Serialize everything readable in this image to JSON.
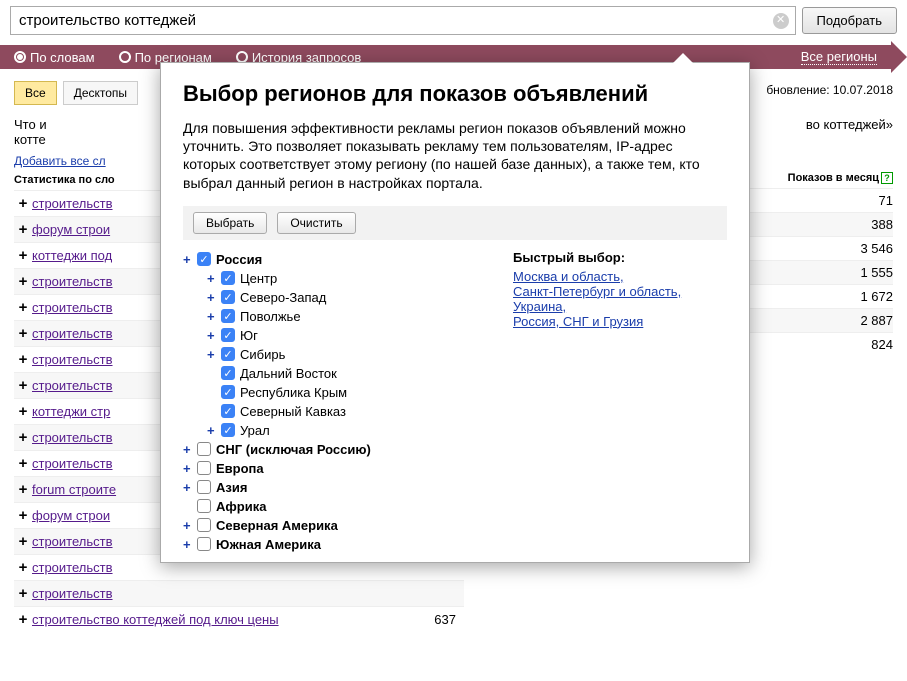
{
  "search": {
    "value": "строительство коттеджей",
    "submit": "Подобрать"
  },
  "modes": {
    "by_words": "По словам",
    "by_regions": "По регионам",
    "history": "История запросов",
    "all_regions": "Все регионы"
  },
  "tabs": {
    "all": "Все",
    "desktop": "Десктопы"
  },
  "update_label": "бновление: 10.07.2018",
  "left": {
    "heading1": "Что и",
    "heading2": "котте",
    "add_all": "Добавить все сл",
    "stat_header": "Статистика по сло"
  },
  "right": {
    "heading_suffix": "во коттеджей»",
    "shows_label": "Показов в месяц"
  },
  "keywords": [
    {
      "text": "строительств",
      "count": ""
    },
    {
      "text": "форум строи",
      "count": ""
    },
    {
      "text": "коттеджи под",
      "count": ""
    },
    {
      "text": "строительств",
      "count": ""
    },
    {
      "text": "строительств",
      "count": ""
    },
    {
      "text": "строительств",
      "count": ""
    },
    {
      "text": "строительств",
      "count": ""
    },
    {
      "text": "строительств",
      "count": ""
    },
    {
      "text": "коттеджи стр",
      "count": ""
    },
    {
      "text": "строительств",
      "count": ""
    },
    {
      "text": "строительств",
      "count": ""
    },
    {
      "text": "forum строите",
      "count": ""
    },
    {
      "text": "форум строи",
      "count": ""
    },
    {
      "text": "строительств",
      "count": ""
    },
    {
      "text": "строительств",
      "count": ""
    },
    {
      "text": "строительств",
      "count": ""
    },
    {
      "text": "строительство коттеджей под ключ цены",
      "count": "637"
    }
  ],
  "right_values": [
    "71",
    "388",
    "3 546",
    "1 555",
    "1 672",
    "2 887",
    "824"
  ],
  "popup": {
    "title": "Выбор регионов для показов объявлений",
    "desc": "Для повышения эффективности рекламы регион показов объявлений можно уточнить. Это позволяет показывать рекламу тем пользователям, IP-адрес которых соответствует этому региону (по нашей базе данных), а также тем, кто выбрал данный регион в настройках портала.",
    "select_btn": "Выбрать",
    "clear_btn": "Очистить",
    "tree": [
      {
        "label": "Россия",
        "level": 0,
        "checked": true,
        "expand": true,
        "bold": true
      },
      {
        "label": "Центр",
        "level": 1,
        "checked": true,
        "expand": true,
        "bold": false
      },
      {
        "label": "Северо-Запад",
        "level": 1,
        "checked": true,
        "expand": true,
        "bold": false
      },
      {
        "label": "Поволжье",
        "level": 1,
        "checked": true,
        "expand": true,
        "bold": false
      },
      {
        "label": "Юг",
        "level": 1,
        "checked": true,
        "expand": true,
        "bold": false
      },
      {
        "label": "Сибирь",
        "level": 1,
        "checked": true,
        "expand": true,
        "bold": false
      },
      {
        "label": "Дальний Восток",
        "level": 1,
        "checked": true,
        "expand": false,
        "bold": false
      },
      {
        "label": "Республика Крым",
        "level": 1,
        "checked": true,
        "expand": false,
        "bold": false
      },
      {
        "label": "Северный Кавказ",
        "level": 1,
        "checked": true,
        "expand": false,
        "bold": false
      },
      {
        "label": "Урал",
        "level": 1,
        "checked": true,
        "expand": true,
        "bold": false
      },
      {
        "label": "СНГ (исключая Россию)",
        "level": 0,
        "checked": false,
        "expand": true,
        "bold": true
      },
      {
        "label": "Европа",
        "level": 0,
        "checked": false,
        "expand": true,
        "bold": true
      },
      {
        "label": "Азия",
        "level": 0,
        "checked": false,
        "expand": true,
        "bold": true
      },
      {
        "label": "Африка",
        "level": 0,
        "checked": false,
        "expand": false,
        "bold": true
      },
      {
        "label": "Северная Америка",
        "level": 0,
        "checked": false,
        "expand": true,
        "bold": true
      },
      {
        "label": "Южная Америка",
        "level": 0,
        "checked": false,
        "expand": true,
        "bold": true
      }
    ],
    "quick": {
      "title": "Быстрый выбор:",
      "links": [
        "Москва и область,",
        "Санкт-Петербург и область,",
        "Украина,",
        "Россия, СНГ и Грузия"
      ]
    }
  }
}
